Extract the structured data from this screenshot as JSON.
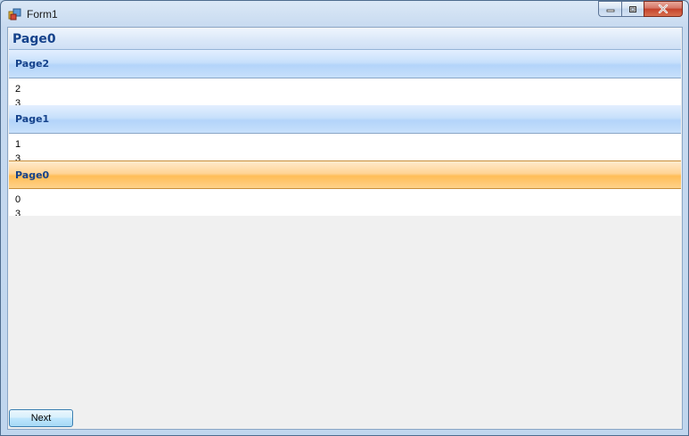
{
  "window": {
    "title": "Form1",
    "icon": "app-icon",
    "controls": [
      "minimize-icon",
      "restore-icon",
      "close-icon"
    ]
  },
  "panel": {
    "header": "Page0",
    "pages": [
      {
        "title": "Page2",
        "line1": "2",
        "line2": "3",
        "active": false
      },
      {
        "title": "Page1",
        "line1": "1",
        "line2": "3",
        "active": false
      },
      {
        "title": "Page0",
        "line1": "0",
        "line2": "3",
        "active": true
      }
    ]
  },
  "buttons": {
    "next_label": "Next"
  },
  "colors": {
    "header_text": "#15428b",
    "active_header": "#ffbd57",
    "inactive_header": "#b3d4fa"
  }
}
